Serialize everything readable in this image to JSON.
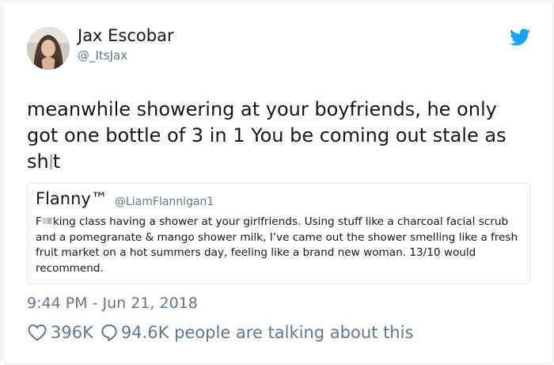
{
  "tweet": {
    "author": {
      "display_name": "Jax Escobar",
      "handle": "@_ItsJax"
    },
    "text_line1": "meanwhile showering at your boyfriends, he only",
    "text_line2": "got one bottle of 3 in 1 You be coming out stale as",
    "text_line3_start": "sh",
    "text_line3_end": "t",
    "timestamp": "9:44 PM - Jun 21, 2018",
    "likes": "396K",
    "talking": "94.6K people are talking about this"
  },
  "quoted_tweet": {
    "display_name": "Flanny™",
    "handle": "@LiamFlannigan1",
    "text_start": "F",
    "text_rest": "king class having a shower at your girlfriends. Using stuff like a charcoal facial scrub and a pomegranate & mango shower milk, I’ve came out the shower smelling like a fresh fruit market on a hot summers day, feeling like a brand new woman. 13/10 would recommend."
  },
  "icons": {
    "platform": "twitter-bird-icon",
    "like": "heart-icon",
    "reply": "speech-bubble-icon"
  },
  "colors": {
    "brand": "#1da1f2",
    "text": "#14171a",
    "muted": "#657786",
    "border": "#e1e8ed"
  }
}
